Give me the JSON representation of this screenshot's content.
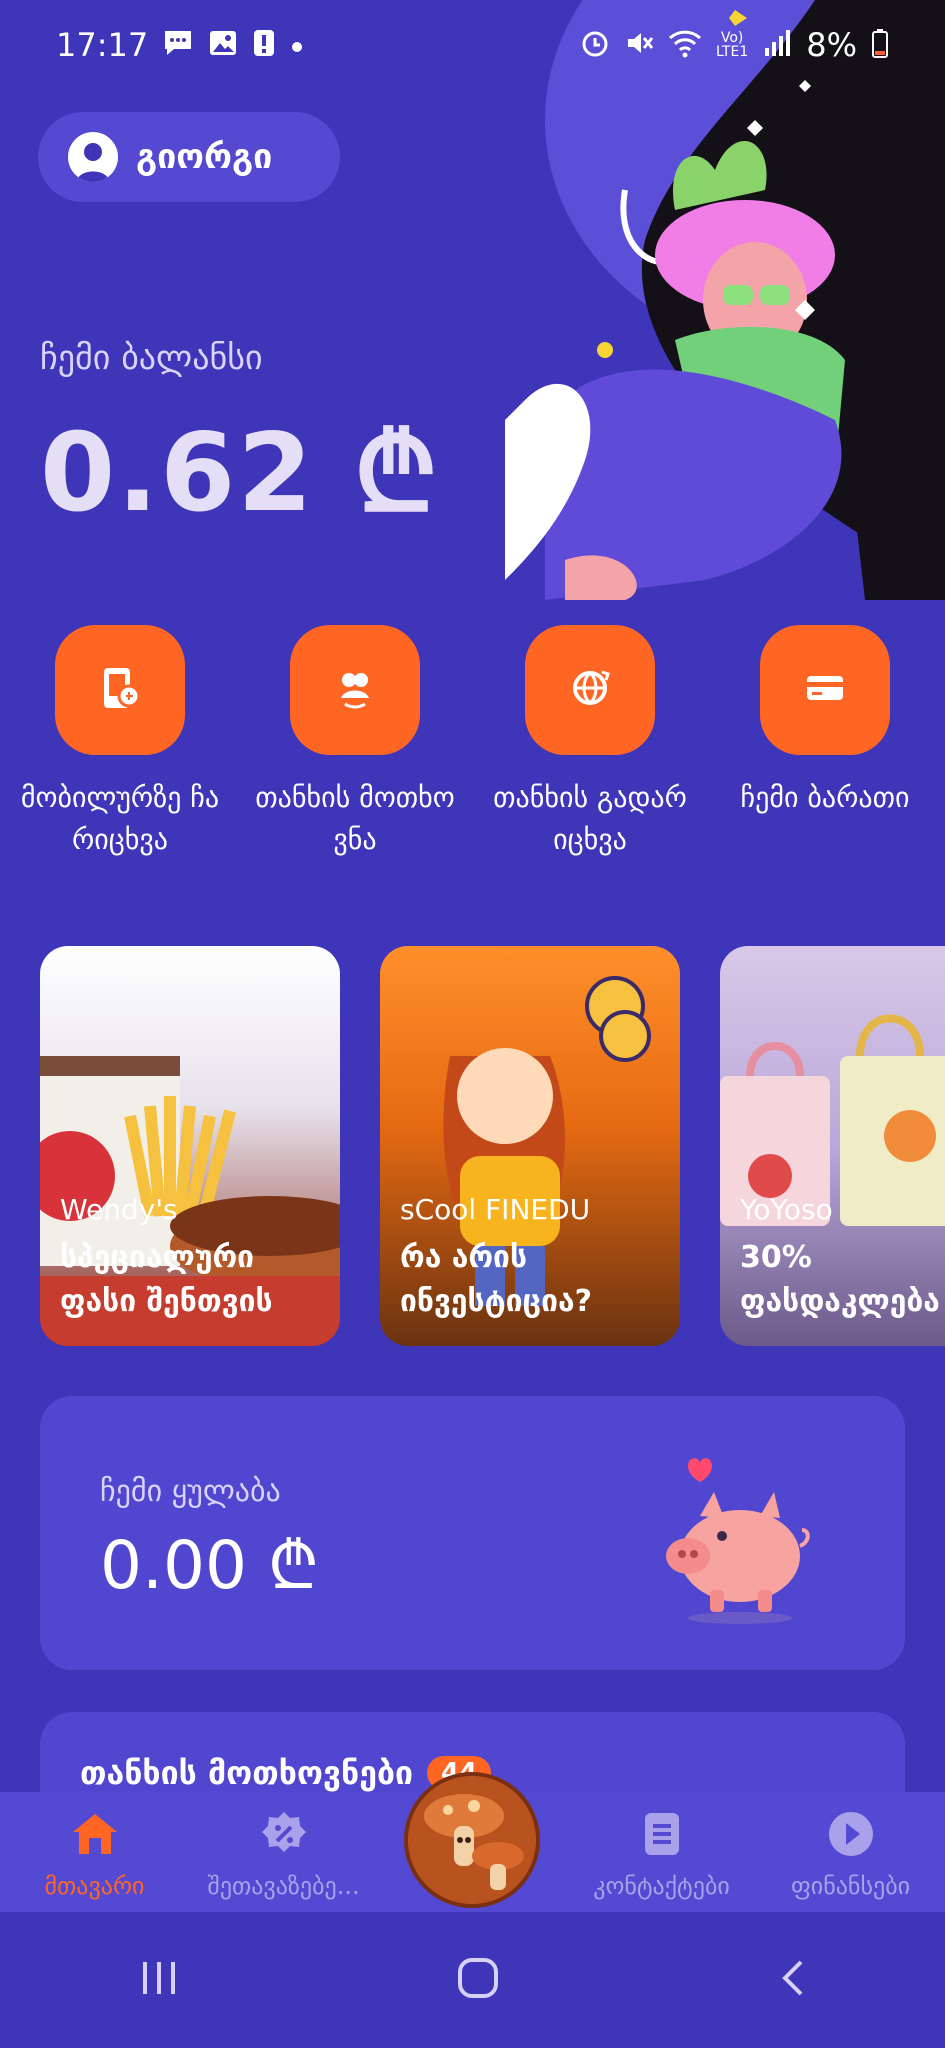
{
  "status_bar": {
    "time": "17:17",
    "battery": "8%",
    "lte": "LTE1",
    "vo": "Vo)"
  },
  "user": {
    "name": "გიორგი"
  },
  "balance": {
    "label": "ჩემი ბალანსი",
    "value": "0.62 ₾"
  },
  "actions": [
    {
      "label": "მობილურზე ჩარიცხვა",
      "icon": "phone-topup-icon"
    },
    {
      "label": "თანხის მოთხოვნა",
      "icon": "request-money-icon"
    },
    {
      "label": "თანხის გადარიცხვა",
      "icon": "transfer-icon"
    },
    {
      "label": "ჩემი ბარათი",
      "icon": "card-icon"
    }
  ],
  "promos": [
    {
      "brand": "Wendy's",
      "title_1": "სპეციალური",
      "title_2": "ფასი შენთვის"
    },
    {
      "brand": "sCool FINEDU",
      "title_1": "რა არის",
      "title_2": "ინვესტიცია?"
    },
    {
      "brand": "YoYoso",
      "title_1": "30%",
      "title_2": "ფასდაკლება"
    }
  ],
  "savings": {
    "label": "ჩემი ყულაბა",
    "value": "0.00 ₾"
  },
  "requests": {
    "title": "თანხის მოთხოვნები",
    "count": "44"
  },
  "bottom_nav": [
    {
      "label": "მთავარი",
      "icon": "home-icon",
      "active": true
    },
    {
      "label": "შეთავაზებე...",
      "icon": "discount-icon",
      "active": false
    },
    {
      "label": "კონტაქტები",
      "icon": "contacts-icon",
      "active": false
    },
    {
      "label": "ფინანსები",
      "icon": "finance-icon",
      "active": false
    }
  ],
  "colors": {
    "background": "#3f35b8",
    "accent": "#ff6624",
    "card": "#5146d0"
  }
}
